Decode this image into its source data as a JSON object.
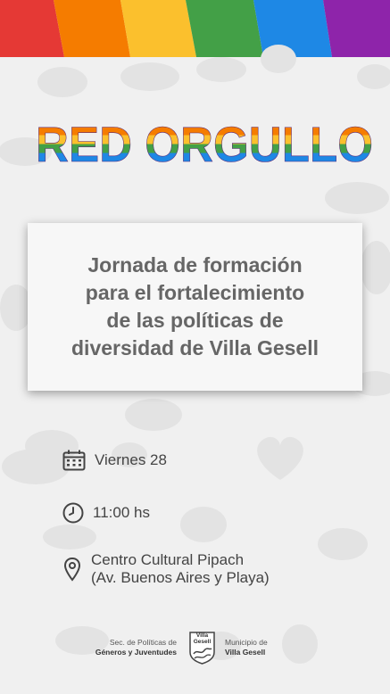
{
  "header": {
    "stripe_colors": [
      "#e53935",
      "#f57c00",
      "#fbc02d",
      "#43a047",
      "#1e88e5",
      "#8e24aa"
    ]
  },
  "brand": {
    "title": "RED ORGULLO"
  },
  "card": {
    "lines": [
      "Jornada de formación",
      "para el fortalecimiento",
      "de las políticas de",
      "diversidad de Villa Gesell"
    ]
  },
  "event": {
    "date": "Viernes 28",
    "time": "11:00 hs",
    "place_line1": "Centro Cultural Pipach",
    "place_line2": "(Av. Buenos Aires y Playa)",
    "icons": [
      "calendar-icon",
      "clock-icon",
      "location-pin-icon"
    ]
  },
  "footer": {
    "left_line1": "Sec. de Políticas de",
    "left_line2": "Géneros y Juventudes",
    "logo_line1": "Villa",
    "logo_line2": "Gesell",
    "right_line1": "Municipio de",
    "right_line2": "Villa Gesell"
  }
}
